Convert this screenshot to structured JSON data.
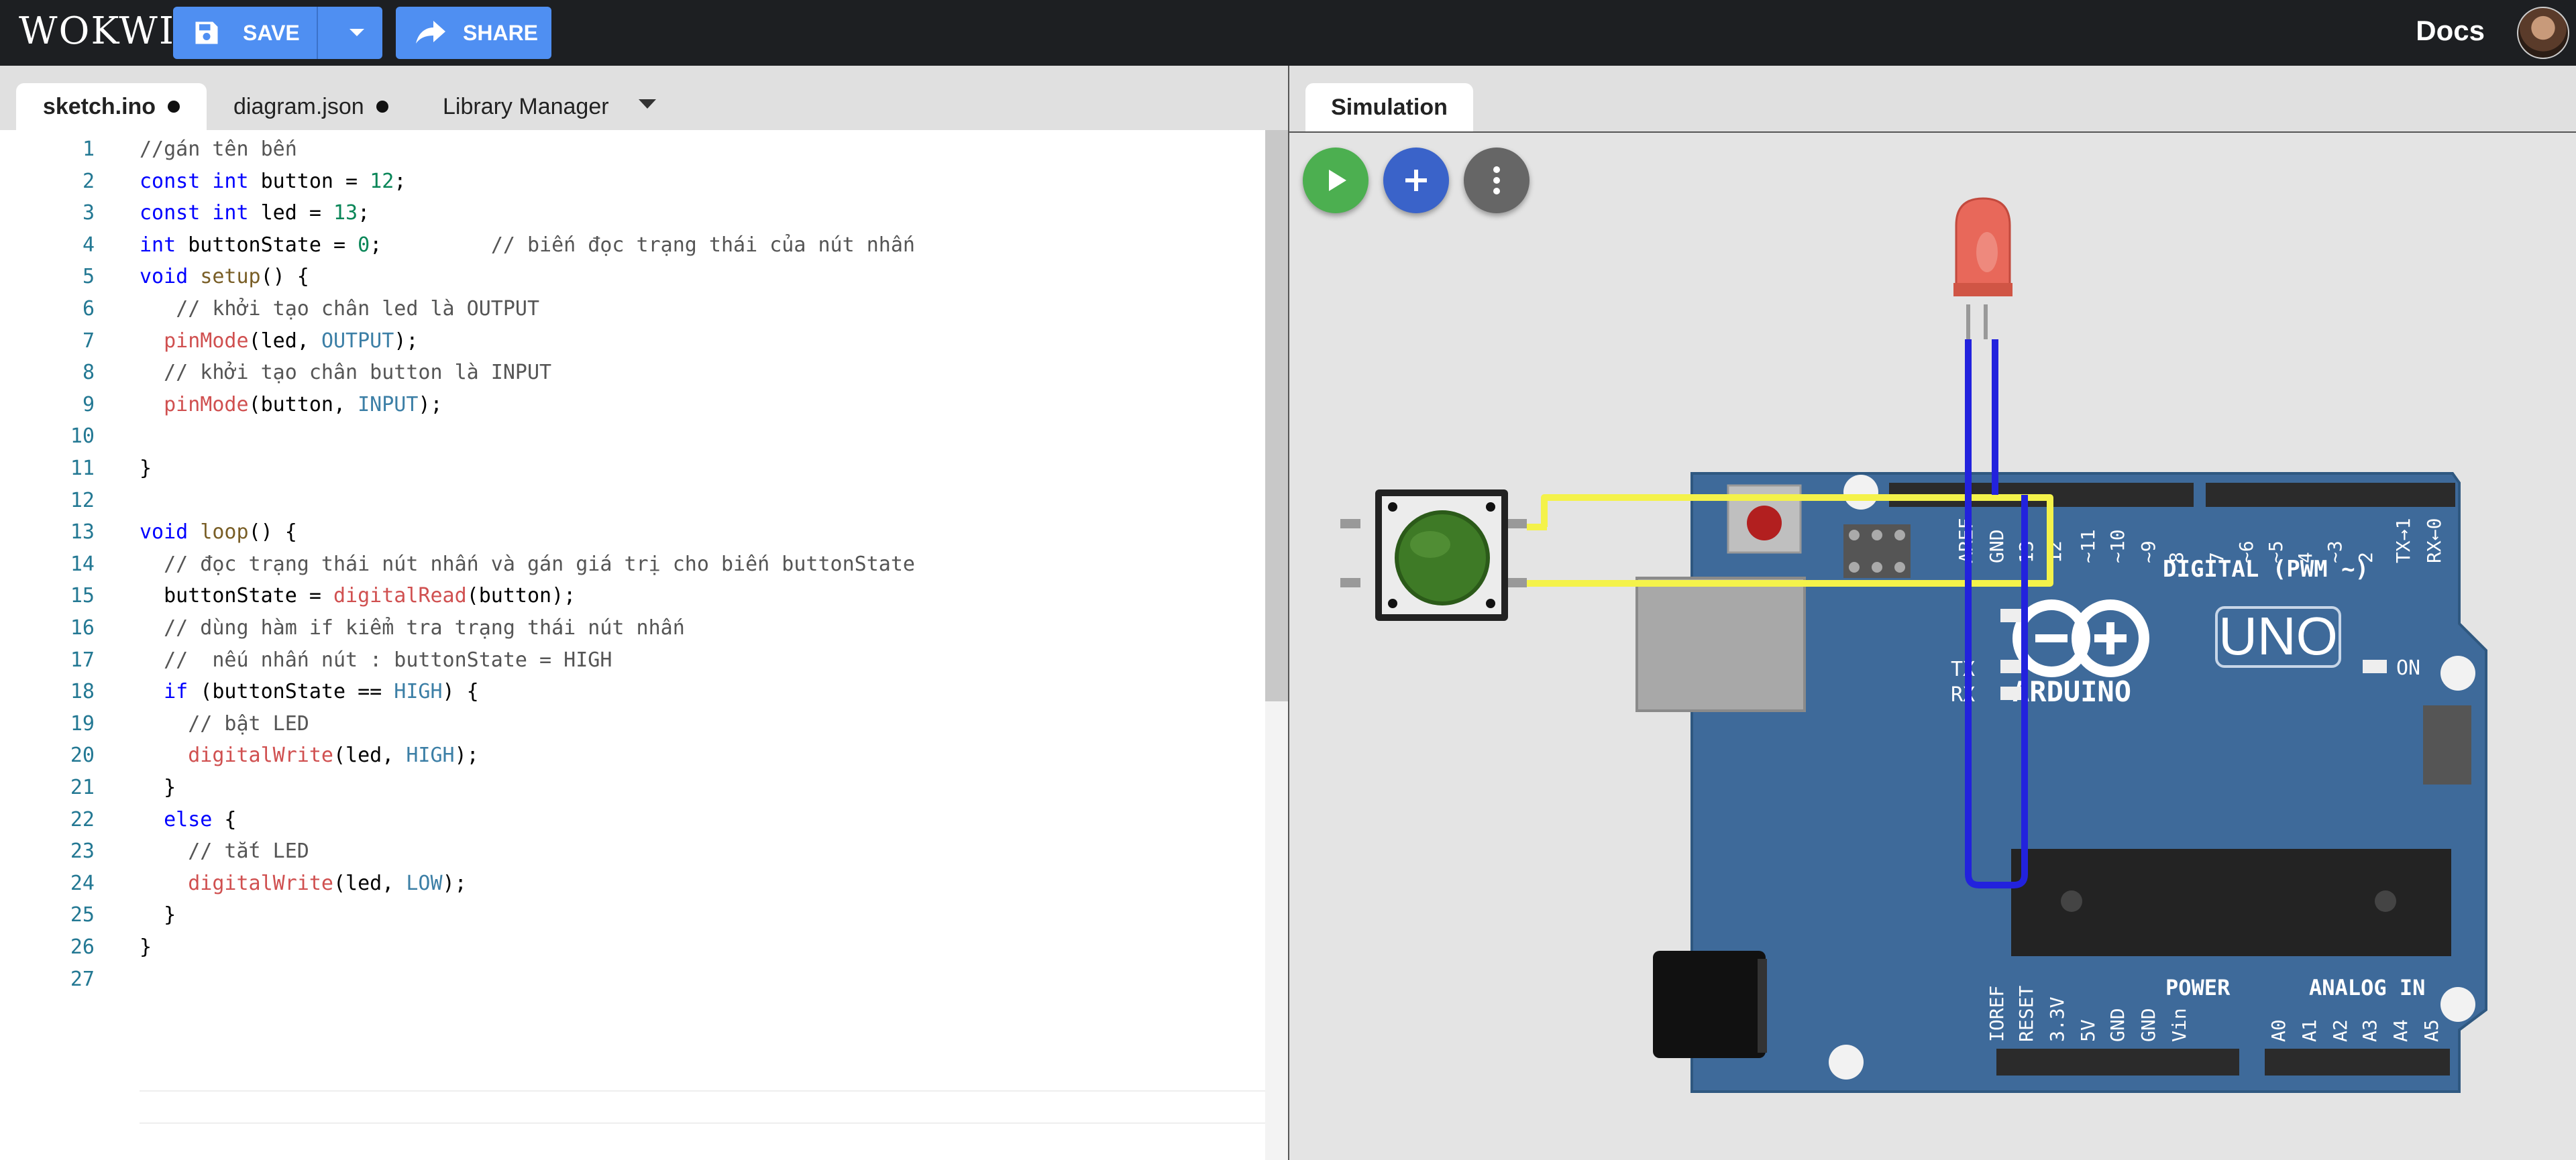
{
  "topbar": {
    "logo": "WOKWI",
    "save_label": "SAVE",
    "share_label": "SHARE",
    "docs_label": "Docs"
  },
  "editor_tabs": [
    {
      "label": "sketch.ino",
      "modified": true
    },
    {
      "label": "diagram.json",
      "modified": true
    },
    {
      "label": "Library Manager"
    }
  ],
  "simulation": {
    "tab_label": "Simulation",
    "board": {
      "name": "UNO",
      "brand": "ARDUINO",
      "on_label": "ON",
      "digital_label": "DIGITAL (PWM ~)",
      "power_label": "POWER",
      "analog_label": "ANALOG IN",
      "tx_label": "TX",
      "rx_label": "RX",
      "digital_pins": [
        "AREF",
        "GND",
        "13",
        "12",
        "~11",
        "~10",
        "~9",
        "8",
        "7",
        "~6",
        "~5",
        "4",
        "~3",
        "2",
        "TX→1",
        "RX←0"
      ],
      "power_pins": [
        "IOREF",
        "RESET",
        "3.3V",
        "5V",
        "GND",
        "GND",
        "Vin"
      ],
      "analog_pins": [
        "A0",
        "A1",
        "A2",
        "A3",
        "A4",
        "A5"
      ]
    },
    "colors": {
      "board": "#3e6a9a",
      "wire_yellow": "#f4f24a",
      "wire_blue": "#2222dd",
      "led": "#e8685a",
      "button_cap": "#3e7a26"
    }
  },
  "code": {
    "line_numbers": [
      "1",
      "2",
      "3",
      "4",
      "5",
      "6",
      "7",
      "8",
      "9",
      "10",
      "11",
      "12",
      "13",
      "14",
      "15",
      "16",
      "17",
      "18",
      "19",
      "20",
      "21",
      "22",
      "23",
      "24",
      "25",
      "26",
      "27"
    ],
    "lines": [
      "//gán tên bến",
      "const int button = 12;",
      "const int led = 13;",
      "int buttonState = 0;         // biến đọc trạng thái của nút nhấn",
      "void setup() {",
      "   // khởi tạo chân led là OUTPUT",
      "  pinMode(led, OUTPUT);",
      "  // khởi tạo chân button là INPUT",
      "  pinMode(button, INPUT);",
      "",
      "}",
      "",
      "void loop() {",
      "  // đọc trạng thái nút nhấn và gán giá trị cho biến buttonState",
      "  buttonState = digitalRead(button);",
      "  // dùng hàm if kiểm tra trạng thái nút nhấn",
      "  //  nếu nhấn nút : buttonState = HIGH",
      "  if (buttonState == HIGH) {",
      "    // bật LED",
      "    digitalWrite(led, HIGH);",
      "  }",
      "  else {",
      "    // tắt LED",
      "    digitalWrite(led, LOW);",
      "  }",
      "}",
      ""
    ]
  }
}
